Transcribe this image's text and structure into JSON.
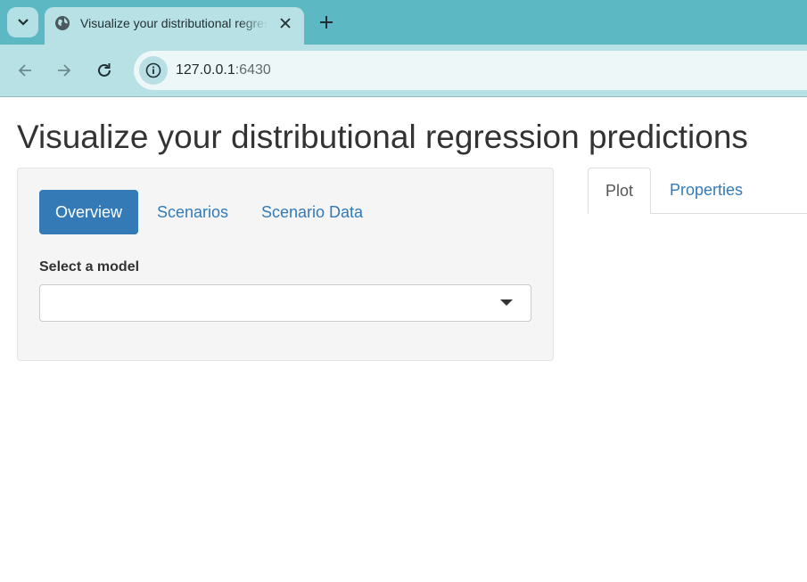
{
  "browser": {
    "tab_title": "Visualize your distributional regression predictions",
    "url_host": "127.0.0.1",
    "url_port": ":6430",
    "icons": {
      "tab_search": "chevron-down-icon",
      "favicon": "globe-icon",
      "close": "close-icon",
      "new_tab": "plus-icon",
      "back": "arrow-left-icon",
      "forward": "arrow-right-icon",
      "reload": "reload-icon",
      "site_info": "info-icon"
    },
    "colors": {
      "tabstrip": "#5cb8c2",
      "toolbar": "#b7e1e5",
      "omnibox": "#edf7f8"
    }
  },
  "page": {
    "title": "Visualize your distributional regression predictions",
    "sidebar": {
      "pills": [
        {
          "label": "Overview",
          "active": true
        },
        {
          "label": "Scenarios",
          "active": false
        },
        {
          "label": "Scenario Data",
          "active": false
        }
      ],
      "model_select": {
        "label": "Select a model",
        "value": ""
      }
    },
    "main": {
      "tabs": [
        {
          "label": "Plot",
          "active": true
        },
        {
          "label": "Properties",
          "active": false
        }
      ]
    },
    "colors": {
      "accent": "#337ab7",
      "panel_bg": "#f5f5f5",
      "text": "#333333"
    }
  }
}
